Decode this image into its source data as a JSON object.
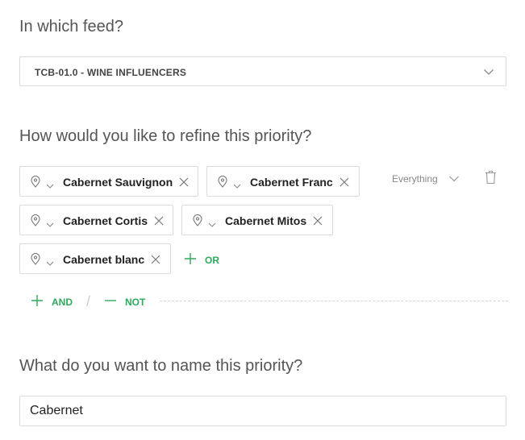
{
  "feed_section": {
    "heading": "In which feed?",
    "selected_feed": "TCB-01.0 - WINE INFLUENCERS"
  },
  "refine_section": {
    "heading": "How would you like to refine this priority?",
    "chips": [
      {
        "label": "Cabernet Sauvignon"
      },
      {
        "label": "Cabernet Franc"
      },
      {
        "label": "Cabernet Cortis"
      },
      {
        "label": "Cabernet Mitos"
      },
      {
        "label": "Cabernet blanc"
      }
    ],
    "or_label": "OR",
    "and_label": "AND",
    "separator": "/",
    "not_label": "NOT",
    "scope_label": "Everything"
  },
  "name_section": {
    "heading": "What do you want to name this priority?",
    "name_value": "Cabernet"
  },
  "colors": {
    "accent_green": "#2eaa5c",
    "border": "#dcdcdc",
    "heading_text": "#555555"
  }
}
